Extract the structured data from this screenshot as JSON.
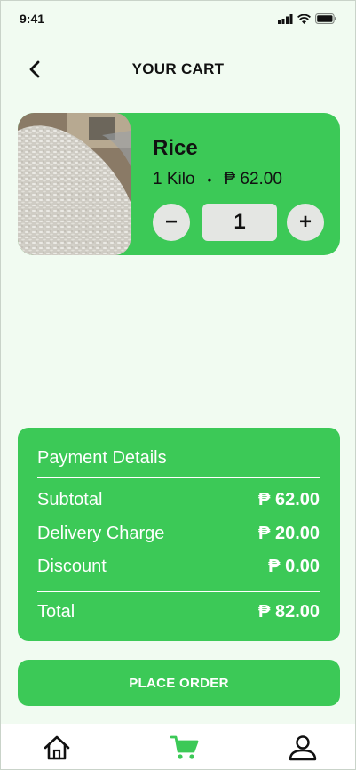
{
  "status_bar": {
    "time": "9:41"
  },
  "header": {
    "title": "YOUR CART"
  },
  "cart": {
    "items": [
      {
        "name": "Rice",
        "unit": "1 Kilo",
        "separator": "•",
        "price": "₱ 62.00",
        "quantity": "1",
        "minus_label": "−",
        "plus_label": "+"
      }
    ]
  },
  "payment": {
    "title": "Payment Details",
    "rows": [
      {
        "label": "Subtotal",
        "amount": "₱ 62.00"
      },
      {
        "label": "Delivery Charge",
        "amount": "₱ 20.00"
      },
      {
        "label": "Discount",
        "amount": "₱ 0.00"
      }
    ],
    "total": {
      "label": "Total",
      "amount": "₱ 82.00"
    }
  },
  "actions": {
    "place_order": "PLACE ORDER"
  },
  "colors": {
    "accent": "#3cc957",
    "background": "#f1fbf1",
    "button_grey": "#e4e6e3"
  },
  "nav": {
    "icons": [
      "home-icon",
      "cart-icon",
      "profile-icon"
    ],
    "active": "cart-icon"
  }
}
